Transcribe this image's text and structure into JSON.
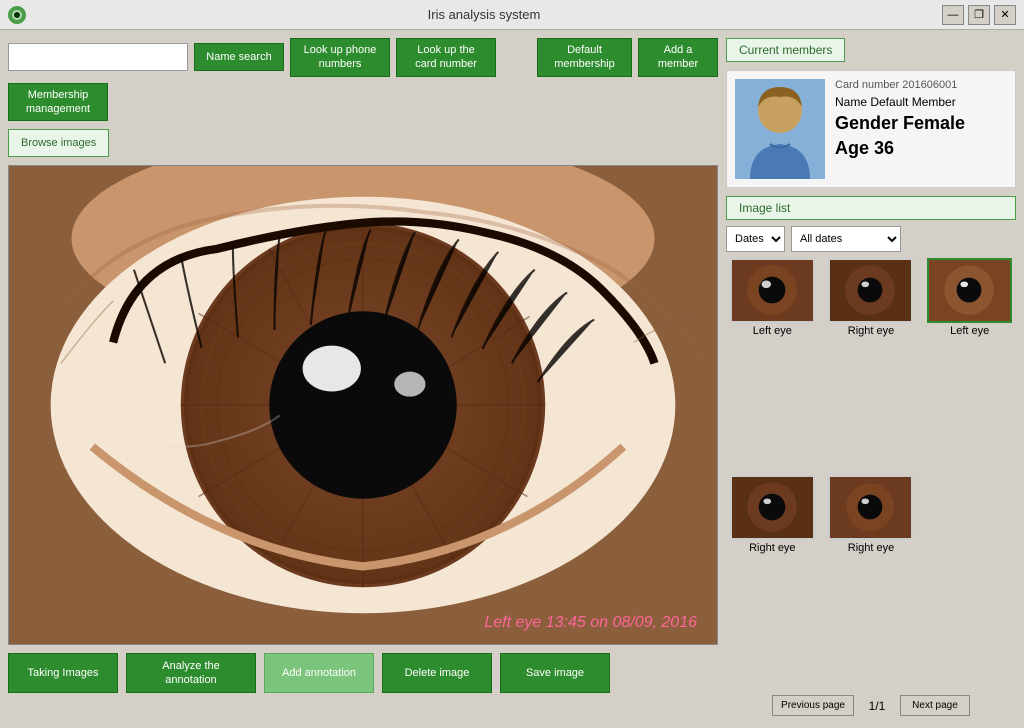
{
  "window": {
    "title": "Iris analysis system",
    "icon": "eye-icon"
  },
  "titlebar": {
    "minimize_label": "—",
    "restore_label": "❐",
    "close_label": "✕"
  },
  "toolbar": {
    "search_placeholder": "",
    "name_search_label": "Name search",
    "lookup_phone_label": "Look up phone numbers",
    "lookup_card_label": "Look up the card number",
    "default_membership_label": "Default membership",
    "add_member_label": "Add a member",
    "membership_management_label": "Membership management"
  },
  "browse_btn_label": "Browse images",
  "image_overlay_label": "Left eye 13:45 on 08/09, 2016",
  "bottom_toolbar": {
    "taking_images_label": "Taking Images",
    "analyze_annotation_label": "Analyze the annotation",
    "add_annotation_label": "Add annotation",
    "delete_image_label": "Delete image",
    "save_image_label": "Save image"
  },
  "right_panel": {
    "current_members_label": "Current members",
    "card_number": "Card number 201606001",
    "member_name": "Name Default Member",
    "gender": "Gender Female",
    "age": "Age 36",
    "image_list_label": "Image list",
    "dates_label": "Dates",
    "dates_option": "Dates",
    "all_dates_option": "All dates",
    "thumbnails": [
      {
        "label": "Left eye",
        "selected": false,
        "eye": "left"
      },
      {
        "label": "Right eye",
        "selected": false,
        "eye": "right"
      },
      {
        "label": "Left eye",
        "selected": true,
        "eye": "left"
      },
      {
        "label": "Right eye",
        "selected": false,
        "eye": "right"
      },
      {
        "label": "Right eye",
        "selected": false,
        "eye": "right"
      }
    ],
    "page_info": "1/1",
    "previous_page_label": "Previous page",
    "next_page_label": "Next page"
  },
  "colors": {
    "green_btn": "#2d8c2d",
    "selected_border": "#2d8c2d",
    "image_label_color": "#ff6699"
  }
}
